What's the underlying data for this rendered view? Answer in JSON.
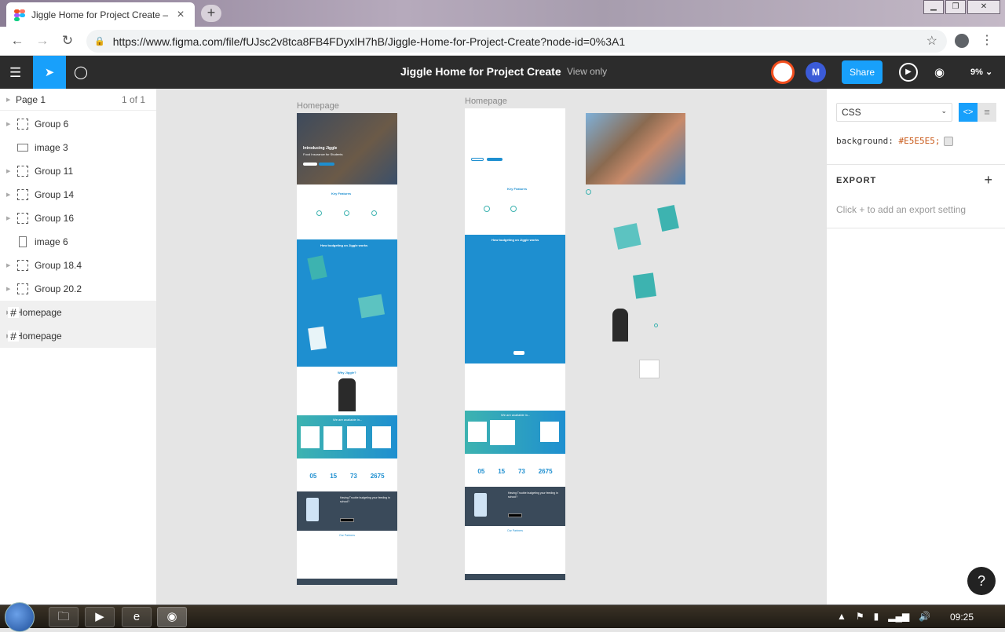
{
  "browser": {
    "tab_title": "Jiggle Home for Project Create –",
    "url": "https://www.figma.com/file/fUJsc2v8tca8FB4FDyxlH7hB/Jiggle-Home-for-Project-Create?node-id=0%3A1"
  },
  "figma": {
    "file_title": "Jiggle Home for Project Create",
    "mode": "View only",
    "avatar_letter": "M",
    "share_label": "Share",
    "zoom": "9%"
  },
  "layers_panel": {
    "page_name": "Page 1",
    "page_count": "1 of 1",
    "layers": [
      {
        "name": "Group 6",
        "type": "group"
      },
      {
        "name": "image 3",
        "type": "image"
      },
      {
        "name": "Group 11",
        "type": "group"
      },
      {
        "name": "Group 14",
        "type": "group"
      },
      {
        "name": "Group 16",
        "type": "group"
      },
      {
        "name": "image 6",
        "type": "image-vertical"
      },
      {
        "name": "Group 18.4",
        "type": "group"
      },
      {
        "name": "Group 20.2",
        "type": "group"
      },
      {
        "name": "Homepage",
        "type": "frame"
      },
      {
        "name": "Homepage",
        "type": "frame"
      }
    ]
  },
  "canvas": {
    "frame1_label": "Homepage",
    "frame2_label": "Homepage",
    "frame1_heading": "Introducing Jiggle",
    "frame1_sub": "Food Insurance for Students",
    "key_features": "Key Features",
    "how_it_works": "How budgeting on Jiggle works",
    "why_jiggle": "Why Jiggle?",
    "available": "We are available in...",
    "stats": [
      "05",
      "15",
      "73",
      "2675"
    ],
    "having_trouble": "Having Trouble budgeting your feeding in school?",
    "partners": "Our Partners"
  },
  "properties": {
    "code_lang": "CSS",
    "css_property": "background:",
    "css_value": "#E5E5E5;",
    "export_heading": "EXPORT",
    "export_hint": "Click + to add an export setting"
  },
  "taskbar": {
    "time": "09:25"
  },
  "colors": {
    "figma_blue": "#18a0fb",
    "toolbar_bg": "#2c2c2c",
    "canvas_bg": "#e5e5e5",
    "jiggle_blue": "#1e8fd0",
    "jiggle_teal": "#3db3b0"
  }
}
